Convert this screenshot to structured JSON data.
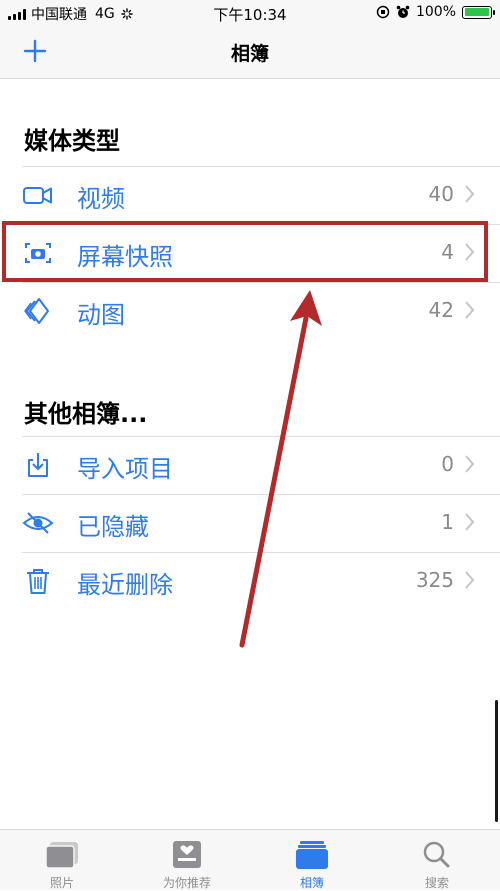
{
  "status_bar": {
    "carrier": "中国联通",
    "network": "4G",
    "time": "下午10:34",
    "battery_text": "100%",
    "battery_level": 1.0
  },
  "nav": {
    "title": "相簿",
    "add_icon": "plus-icon"
  },
  "media_types": {
    "title": "媒体类型",
    "items": [
      {
        "label": "视频",
        "count": "40",
        "icon": "video-camera-icon"
      },
      {
        "label": "屏幕快照",
        "count": "4",
        "icon": "screenshot-icon"
      },
      {
        "label": "动图",
        "count": "42",
        "icon": "live-photo-icon"
      }
    ]
  },
  "other_albums": {
    "title": "其他相簿...",
    "items": [
      {
        "label": "导入项目",
        "count": "0",
        "icon": "import-icon"
      },
      {
        "label": "已隐藏",
        "count": "1",
        "icon": "hidden-eye-icon"
      },
      {
        "label": "最近删除",
        "count": "325",
        "icon": "trash-icon"
      }
    ]
  },
  "tabs": [
    {
      "label": "照片",
      "icon": "photos-icon",
      "active": false
    },
    {
      "label": "为你推荐",
      "icon": "for-you-icon",
      "active": false
    },
    {
      "label": "相簿",
      "icon": "albums-icon",
      "active": true
    },
    {
      "label": "搜索",
      "icon": "search-icon",
      "active": false
    }
  ],
  "colors": {
    "accent": "#2f7bea",
    "annotation": "#b22a2a",
    "secondary_text": "#8a8a8e"
  }
}
